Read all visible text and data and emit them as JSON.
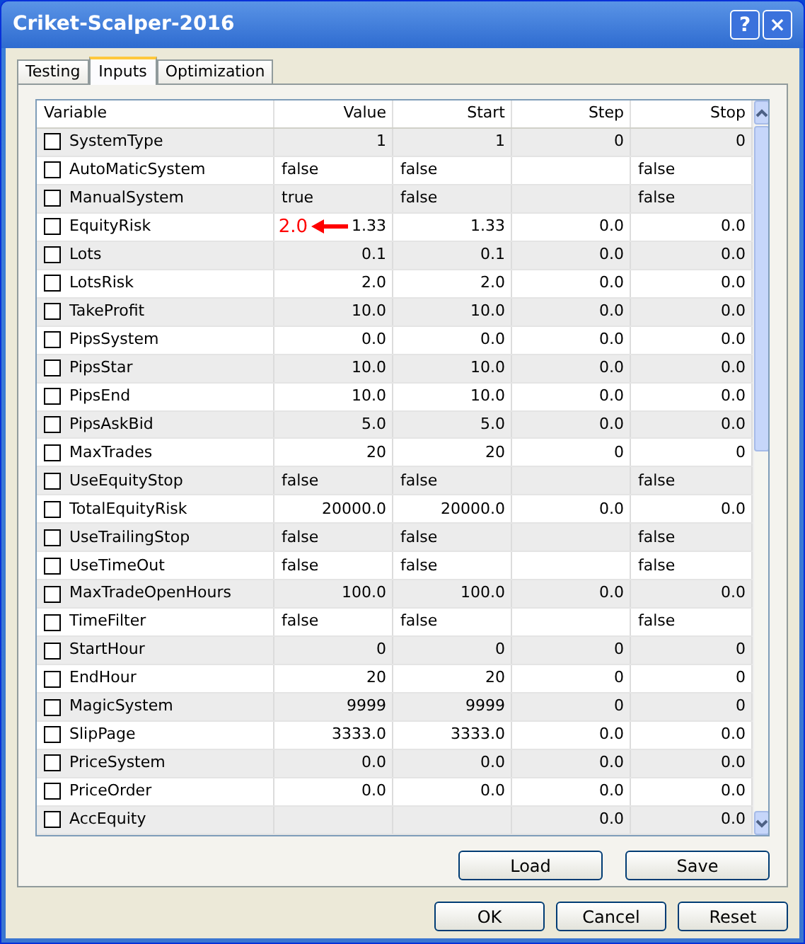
{
  "window": {
    "title": "Criket-Scalper-2016",
    "buttons": [
      "?",
      "×"
    ]
  },
  "tabs": [
    {
      "label": "Testing",
      "selected": false
    },
    {
      "label": "Inputs",
      "selected": true
    },
    {
      "label": "Optimization",
      "selected": false
    }
  ],
  "table": {
    "columns": [
      "Variable",
      "Value",
      "Start",
      "Step",
      "Stop"
    ],
    "rows": [
      {
        "name": "SystemType",
        "checked": false,
        "value": "1",
        "start": "1",
        "step": "0",
        "stop": "0"
      },
      {
        "name": "AutoMaticSystem",
        "checked": false,
        "value": "false",
        "start": "false",
        "step": "",
        "stop": "false"
      },
      {
        "name": "ManualSystem",
        "checked": false,
        "value": "true",
        "start": "false",
        "step": "",
        "stop": "false"
      },
      {
        "name": "EquityRisk",
        "checked": false,
        "value": "1.33",
        "start": "1.33",
        "step": "0.0",
        "stop": "0.0",
        "annotation": "2.0"
      },
      {
        "name": "Lots",
        "checked": false,
        "value": "0.1",
        "start": "0.1",
        "step": "0.0",
        "stop": "0.0"
      },
      {
        "name": "LotsRisk",
        "checked": false,
        "value": "2.0",
        "start": "2.0",
        "step": "0.0",
        "stop": "0.0"
      },
      {
        "name": "TakeProfit",
        "checked": false,
        "value": "10.0",
        "start": "10.0",
        "step": "0.0",
        "stop": "0.0"
      },
      {
        "name": "PipsSystem",
        "checked": false,
        "value": "0.0",
        "start": "0.0",
        "step": "0.0",
        "stop": "0.0"
      },
      {
        "name": "PipsStar",
        "checked": false,
        "value": "10.0",
        "start": "10.0",
        "step": "0.0",
        "stop": "0.0"
      },
      {
        "name": "PipsEnd",
        "checked": false,
        "value": "10.0",
        "start": "10.0",
        "step": "0.0",
        "stop": "0.0"
      },
      {
        "name": "PipsAskBid",
        "checked": false,
        "value": "5.0",
        "start": "5.0",
        "step": "0.0",
        "stop": "0.0"
      },
      {
        "name": "MaxTrades",
        "checked": false,
        "value": "20",
        "start": "20",
        "step": "0",
        "stop": "0"
      },
      {
        "name": "UseEquityStop",
        "checked": false,
        "value": "false",
        "start": "false",
        "step": "",
        "stop": "false"
      },
      {
        "name": "TotalEquityRisk",
        "checked": false,
        "value": "20000.0",
        "start": "20000.0",
        "step": "0.0",
        "stop": "0.0"
      },
      {
        "name": "UseTrailingStop",
        "checked": false,
        "value": "false",
        "start": "false",
        "step": "",
        "stop": "false"
      },
      {
        "name": "UseTimeOut",
        "checked": false,
        "value": "false",
        "start": "false",
        "step": "",
        "stop": "false"
      },
      {
        "name": "MaxTradeOpenHours",
        "checked": false,
        "value": "100.0",
        "start": "100.0",
        "step": "0.0",
        "stop": "0.0"
      },
      {
        "name": "TimeFilter",
        "checked": false,
        "value": "false",
        "start": "false",
        "step": "",
        "stop": "false"
      },
      {
        "name": "StartHour",
        "checked": false,
        "value": "0",
        "start": "0",
        "step": "0",
        "stop": "0"
      },
      {
        "name": "EndHour",
        "checked": false,
        "value": "20",
        "start": "20",
        "step": "0",
        "stop": "0"
      },
      {
        "name": "MagicSystem",
        "checked": false,
        "value": "9999",
        "start": "9999",
        "step": "0",
        "stop": "0"
      },
      {
        "name": "SlipPage",
        "checked": false,
        "value": "3333.0",
        "start": "3333.0",
        "step": "0.0",
        "stop": "0.0"
      },
      {
        "name": "PriceSystem",
        "checked": false,
        "value": "0.0",
        "start": "0.0",
        "step": "0.0",
        "stop": "0.0"
      },
      {
        "name": "PriceOrder",
        "checked": false,
        "value": "0.0",
        "start": "0.0",
        "step": "0.0",
        "stop": "0.0"
      },
      {
        "name": "AccEquity",
        "checked": false,
        "value": "",
        "start": "",
        "step": "0.0",
        "stop": "0.0"
      }
    ]
  },
  "panel_buttons": [
    "Load",
    "Save"
  ],
  "dialog_buttons": [
    "OK",
    "Cancel",
    "Reset"
  ]
}
